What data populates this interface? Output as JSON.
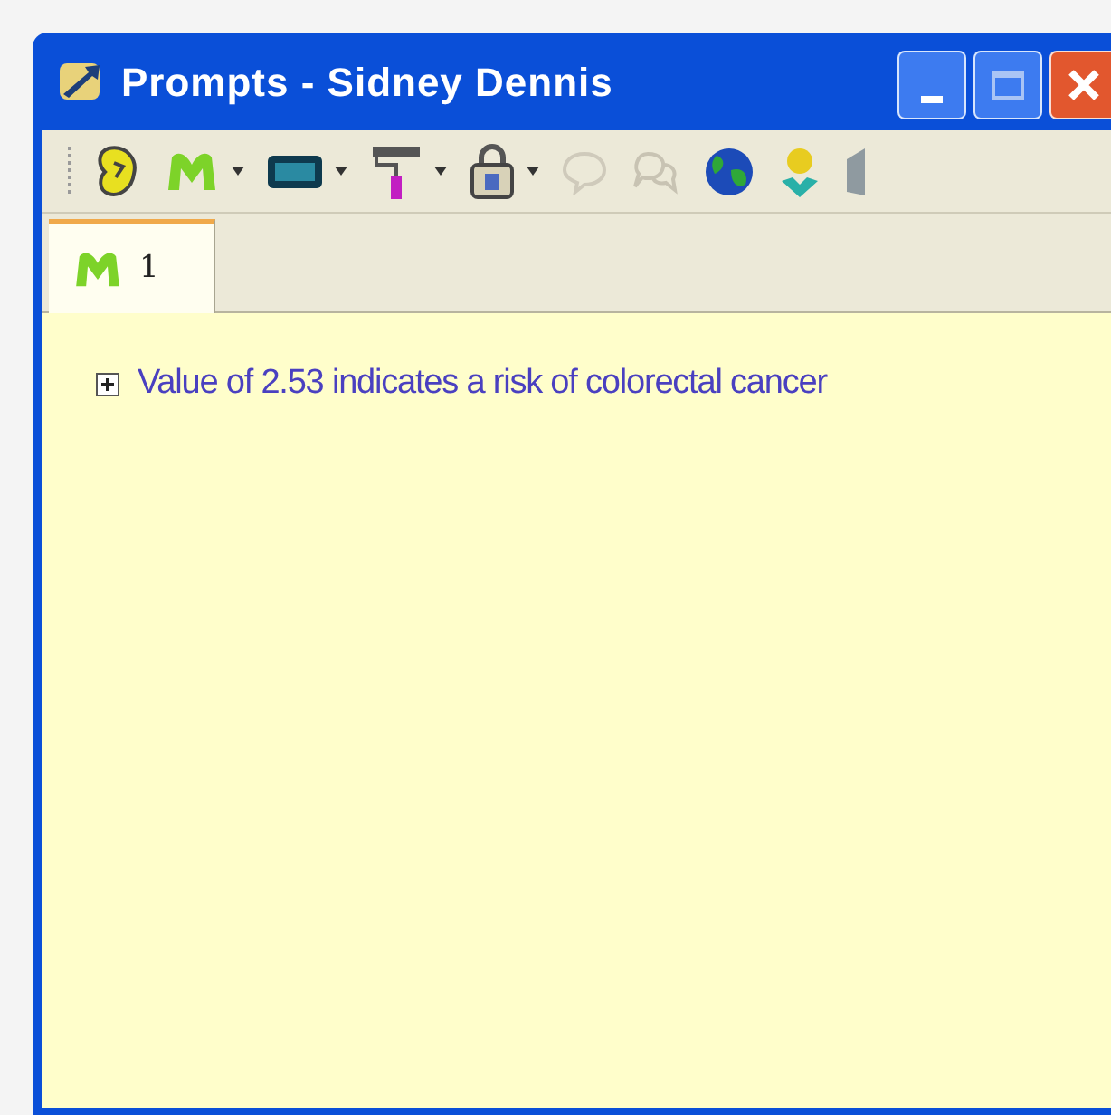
{
  "window": {
    "title": "Prompts - Sidney Dennis"
  },
  "tabs": [
    {
      "label": "1",
      "selected": true
    }
  ],
  "tree": [
    {
      "label": "Value of 2.53 indicates a risk of colorectal cancer",
      "expanded": false
    }
  ]
}
